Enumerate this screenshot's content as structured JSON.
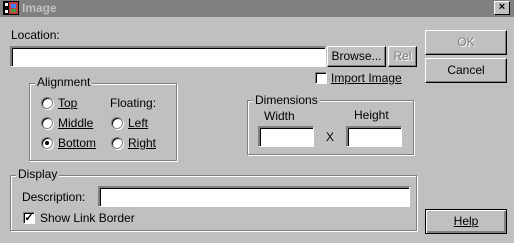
{
  "window": {
    "title": "Image",
    "close_glyph": "×",
    "icon": "film-image-icon"
  },
  "location": {
    "label": "Location:",
    "value": "",
    "browse_label": "Browse...",
    "rel_label": "Rel"
  },
  "import_image": {
    "label": "Import Image",
    "checked": false
  },
  "buttons": {
    "ok": "OK",
    "cancel": "Cancel",
    "help": "Help"
  },
  "alignment": {
    "title": "Alignment",
    "floating_label": "Floating:",
    "options": [
      {
        "label": "Top",
        "selected": false
      },
      {
        "label": "Middle",
        "selected": false
      },
      {
        "label": "Bottom",
        "selected": true
      },
      {
        "label": "Left",
        "selected": false
      },
      {
        "label": "Right",
        "selected": false
      }
    ]
  },
  "dimensions": {
    "title": "Dimensions",
    "width_label": "Width",
    "height_label": "Height",
    "separator": "X",
    "width_value": "",
    "height_value": ""
  },
  "display": {
    "title": "Display",
    "description_label": "Description:",
    "description_value": "",
    "show_link_border_label": "Show Link Border",
    "show_link_border_checked": true
  }
}
